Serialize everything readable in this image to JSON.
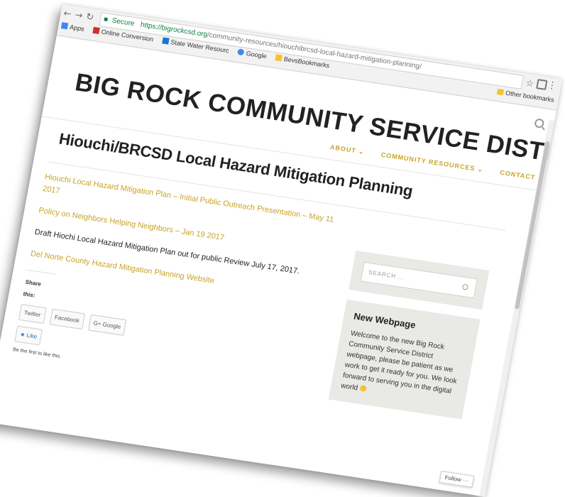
{
  "browser": {
    "secure_label": "Secure",
    "url_host": "https://bigrockcsd.org",
    "url_path": "/community-resources/hiouchibrcsd-local-hazard-mitigation-planning/",
    "bookmarks": [
      {
        "label": "Apps",
        "icon_color": "#4285f4"
      },
      {
        "label": "Online Conversion",
        "icon_color": "#d32f2f"
      },
      {
        "label": "State Water Resourc",
        "icon_color": "#1976d2"
      },
      {
        "label": "Google",
        "icon_color": "#4285f4"
      },
      {
        "label": "BevsBookmarks",
        "icon_color": "#f4c430"
      }
    ],
    "other_bookmarks": "Other bookmarks"
  },
  "site": {
    "title": "BIG ROCK COMMUNITY SERVICE DISTRICT",
    "nav": {
      "about": "ABOUT ⌄",
      "community_resources": "COMMUNITY RESOURCES ⌄",
      "contact": "CONTACT"
    },
    "accent": "#c9a227"
  },
  "main": {
    "page_title": "Hiouchi/BRCSD Local Hazard Mitigation Planning",
    "items": [
      {
        "text": "Hiouchi Local Hazard Mitigation Plan – Initial Public Outreach Presentation – May 11 2017",
        "link": true
      },
      {
        "text": "Policy on Neighbors Helping Neighbors – Jan 19 2017",
        "link": true
      },
      {
        "text": "Draft Hiochi Local Hazard Mitigation Plan out for public Review July 17, 2017.",
        "link": false
      },
      {
        "text": "Del Norte County Hazard Mitigation Planning Website",
        "link": true
      }
    ],
    "share_label": "Share this:",
    "share_buttons": [
      "Twitter",
      "Facebook",
      "G+ Google"
    ],
    "like_label": "★ Like",
    "like_note": "Be the first to like this."
  },
  "sidebar": {
    "search_placeholder": "SEARCH ...",
    "widget_title": "New Webpage",
    "widget_text": "Welcome to the new Big Rock Community Service District webpage, please be patient as we work to get it ready for you. We look forward to serving you in the digital world"
  },
  "follow_label": "Follow ···"
}
